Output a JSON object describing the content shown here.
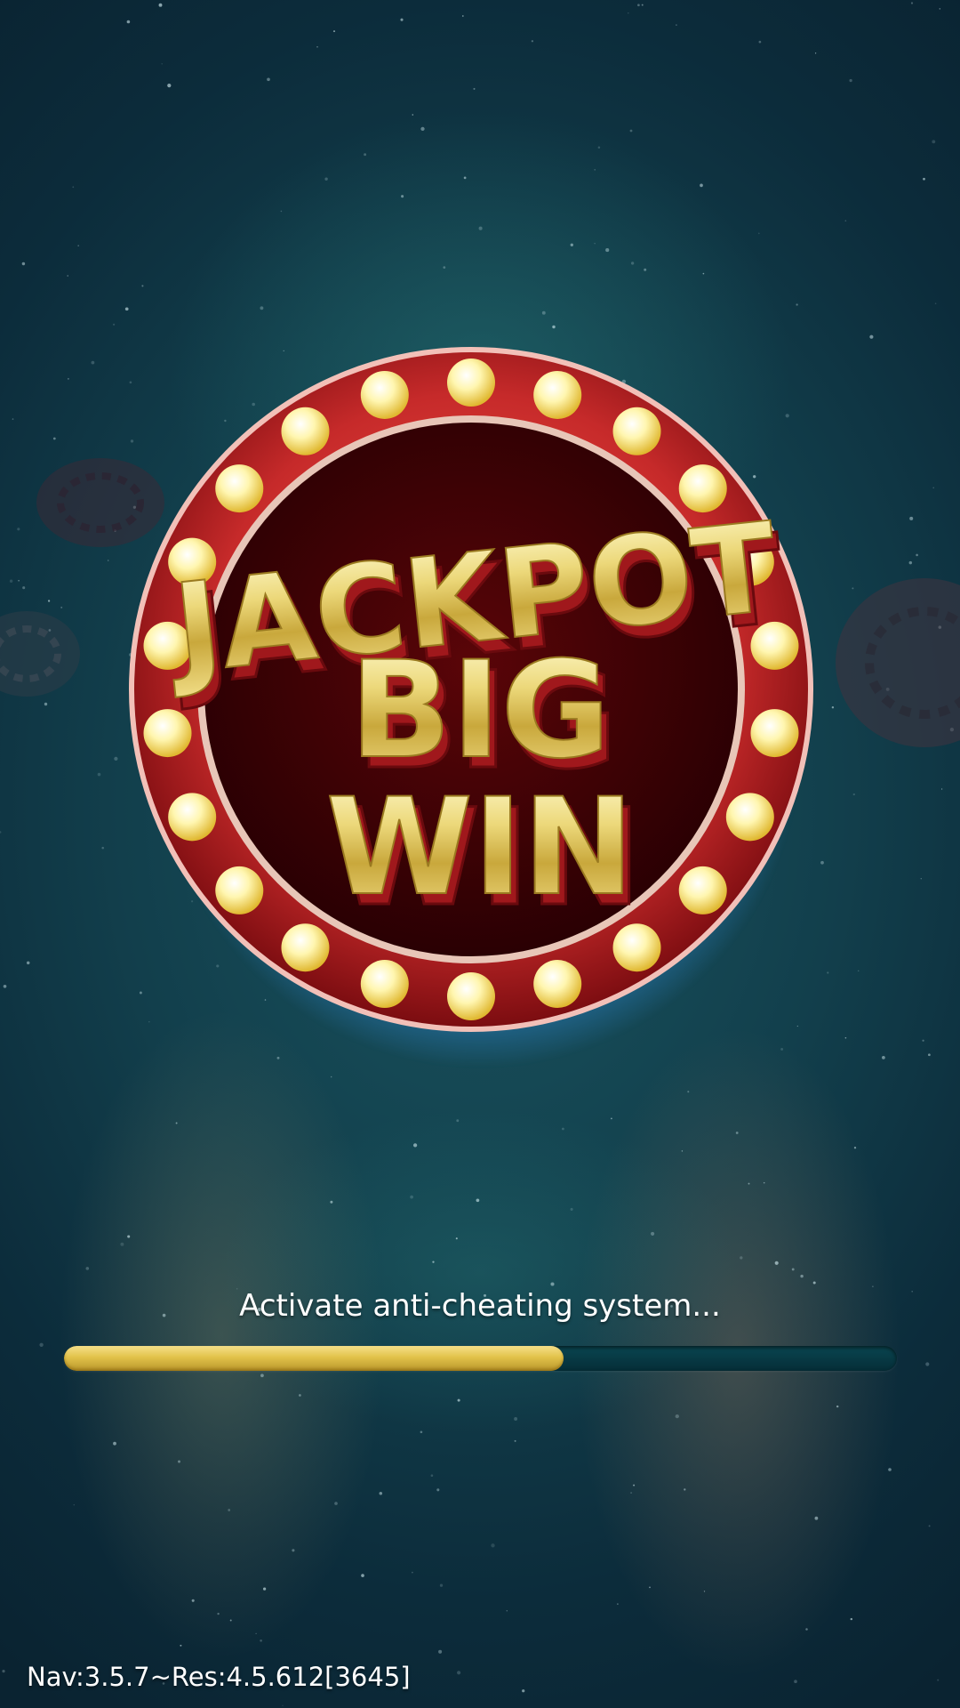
{
  "logo": {
    "line1": "JACKPOT",
    "line2": "BIG",
    "line3": "WIN"
  },
  "loading": {
    "status_text": "Activate anti-cheating system...",
    "progress": 0.6
  },
  "version": {
    "text": "Nav:3.5.7~Res:4.5.612[3645]"
  },
  "colors": {
    "gold": "#e8d26a",
    "red": "#c0262a",
    "dark_red": "#3a0204",
    "bulb": "#fff3a0",
    "track": "#063743"
  }
}
